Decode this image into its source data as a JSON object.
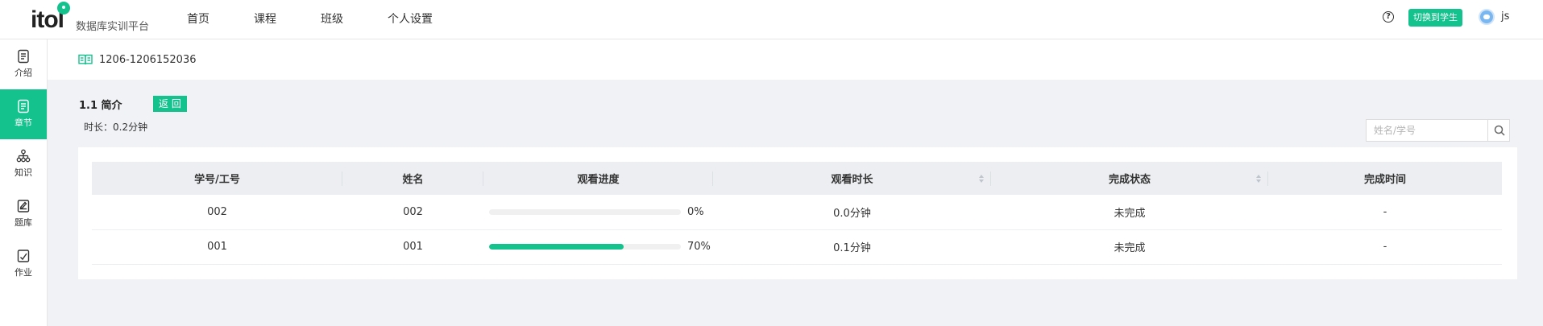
{
  "header": {
    "logo_text": "itol",
    "logo_subtitle": "数据库实训平台",
    "nav": [
      "首页",
      "课程",
      "班级",
      "个人设置"
    ],
    "help_icon": "question-circle-icon",
    "switch_label": "切换到学生",
    "username": "js",
    "accent_color": "#13c28c"
  },
  "sidebar": {
    "items": [
      {
        "label": "介绍",
        "icon": "intro-icon",
        "active": false
      },
      {
        "label": "章节",
        "icon": "chapter-icon",
        "active": true
      },
      {
        "label": "知识",
        "icon": "knowledge-icon",
        "active": false
      },
      {
        "label": "题库",
        "icon": "question-bank-icon",
        "active": false
      },
      {
        "label": "作业",
        "icon": "homework-icon",
        "active": false
      }
    ]
  },
  "course": {
    "code": "1206-1206152036"
  },
  "section": {
    "title": "1.1 简介",
    "back_label": "返 回",
    "duration": "时长：0.2分钟"
  },
  "search": {
    "placeholder": "姓名/学号"
  },
  "table": {
    "columns": [
      "学号/工号",
      "姓名",
      "观看进度",
      "观看时长",
      "完成状态",
      "完成时间"
    ],
    "rows": [
      {
        "id": "002",
        "name": "002",
        "progress": 0,
        "progress_label": "0%",
        "watch_time": "0.0分钟",
        "status": "未完成",
        "finish_time": "-"
      },
      {
        "id": "001",
        "name": "001",
        "progress": 70,
        "progress_label": "70%",
        "watch_time": "0.1分钟",
        "status": "未完成",
        "finish_time": "-"
      }
    ]
  }
}
